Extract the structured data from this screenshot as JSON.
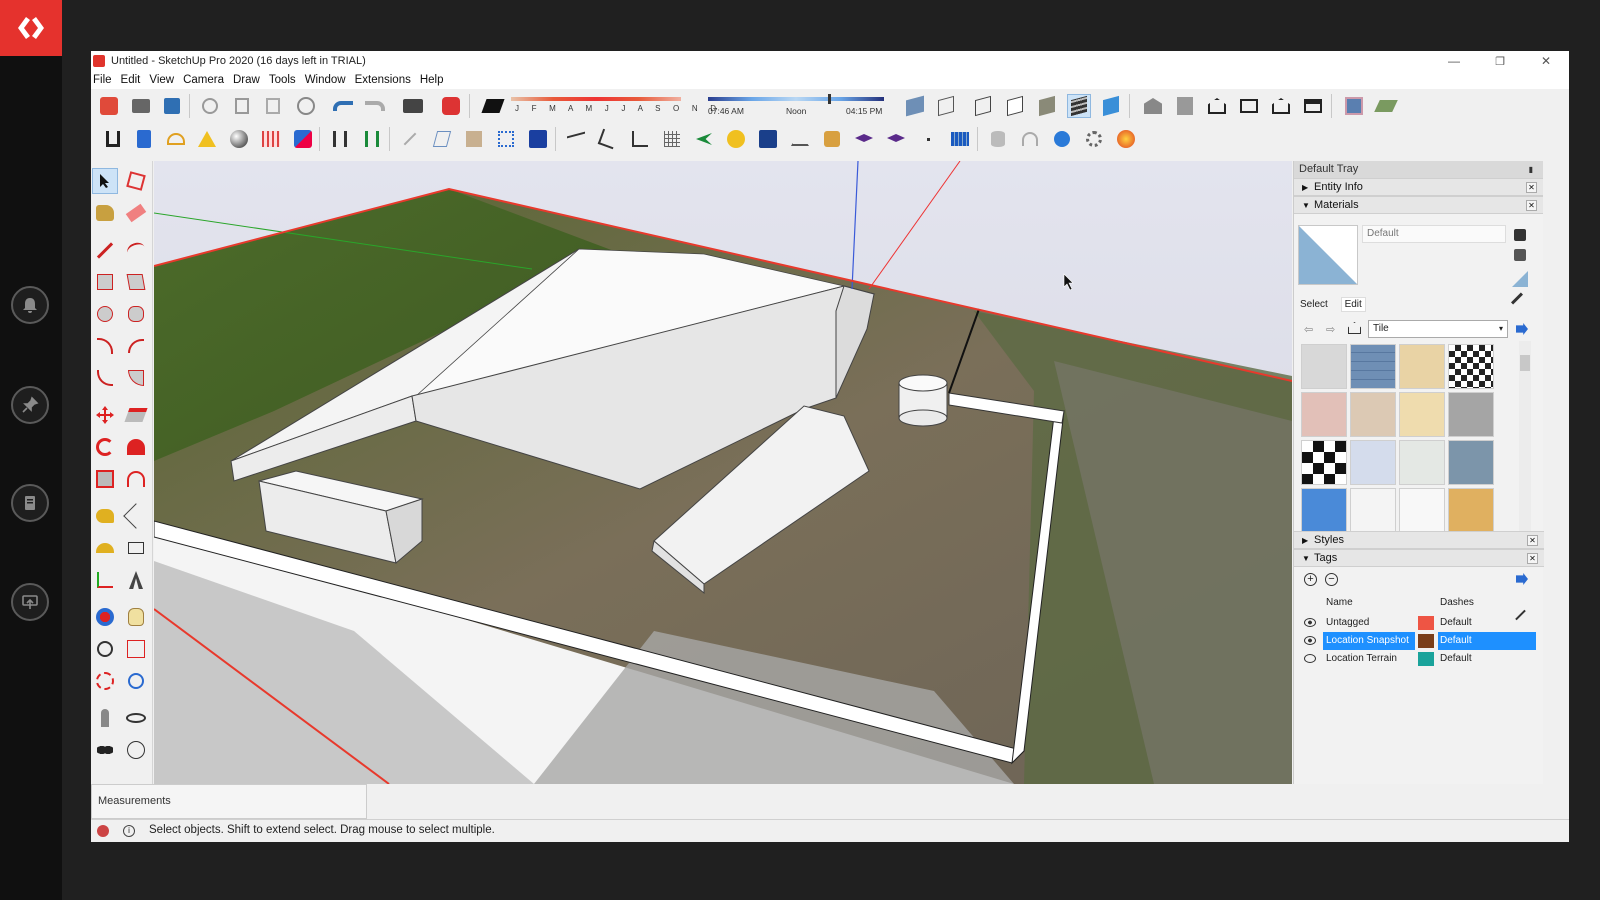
{
  "app": {
    "title": "Untitled - SketchUp Pro 2020 (16 days left in TRIAL)",
    "menu": [
      "File",
      "Edit",
      "View",
      "Camera",
      "Draw",
      "Tools",
      "Window",
      "Extensions",
      "Help"
    ],
    "window_controls": [
      "—",
      "❐",
      "✕"
    ]
  },
  "shadows": {
    "months_label": "J F M A M J J A S O N D",
    "time_start": "07:46 AM",
    "time_mid": "Noon",
    "time_end": "04:15 PM"
  },
  "tray": {
    "title": "Default Tray",
    "panels": {
      "entity_info": "Entity Info",
      "materials": "Materials",
      "styles": "Styles",
      "tags": "Tags"
    },
    "materials": {
      "current_name": "Default",
      "tab_select": "Select",
      "tab_edit": "Edit",
      "library": "Tile",
      "accent": "#8bb3d4"
    },
    "tags": {
      "col_name": "Name",
      "col_dashes": "Dashes",
      "rows": [
        {
          "name": "Untagged",
          "color": "#ee5544",
          "dashes": "Default",
          "selected": false
        },
        {
          "name": "Location Snapshot",
          "color": "#7a3e1a",
          "dashes": "Default",
          "selected": true
        },
        {
          "name": "Location Terrain",
          "color": "#1aa39b",
          "dashes": "Default",
          "selected": false
        }
      ]
    }
  },
  "measurements": {
    "label": "Measurements"
  },
  "status": {
    "text": "Select objects. Shift to extend select. Drag mouse to select multiple."
  },
  "colors": {
    "selection": "#1e90ff",
    "brand_red": "#e5322d"
  }
}
